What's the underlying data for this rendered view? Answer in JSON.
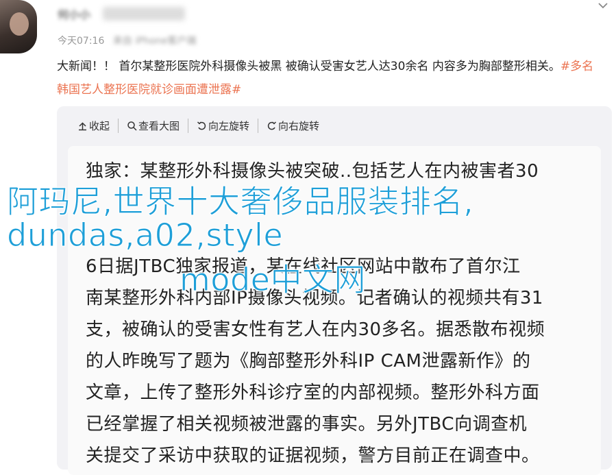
{
  "post": {
    "username": "何小小",
    "time": "今天07:16",
    "source": "来自 iPhone客户端",
    "text": "大新闻！！ 首尔某整形医院外科摄像头被黑 被确认受害女艺人达30余名 内容多为胸部整形相关。",
    "hashtag": "#多名韩国艺人整形医院就诊画面遭泄露#"
  },
  "toolbar": {
    "collapse": "收起",
    "view_large": "查看大图",
    "rotate_left": "向左旋转",
    "rotate_right": "向右旋转"
  },
  "article": {
    "lines": [
      "独家：某整形外科摄像头被突破..包括艺人在内被害者30",
      "",
      "",
      "6日据JTBC独家报道，某在线社区网站中散布了首尔江",
      "南某整形外科内部IP摄像头视频。记者确认的视频共有31",
      "支，被确认的受害女性有艺人在内30多名。据悉散布视频",
      "的人昨晚写了题为《胸部整形外科IP CAM泄露新作》的",
      "文章，上传了整形外科诊疗室的内部视频。整形外科方面",
      "已经掌握了相关视频被泄露的事实。另外JTBC向调查机",
      "关提交了采访中获取的证据视频，警方目前正在调查中。"
    ]
  },
  "watermark": {
    "line1": "阿玛尼,世界十大奢侈品服装排名,",
    "line2": "dundas,a02,style",
    "line3": "mode中文网"
  },
  "colors": {
    "hashtag": "#eb7350",
    "watermark": "#1e9fd8"
  }
}
